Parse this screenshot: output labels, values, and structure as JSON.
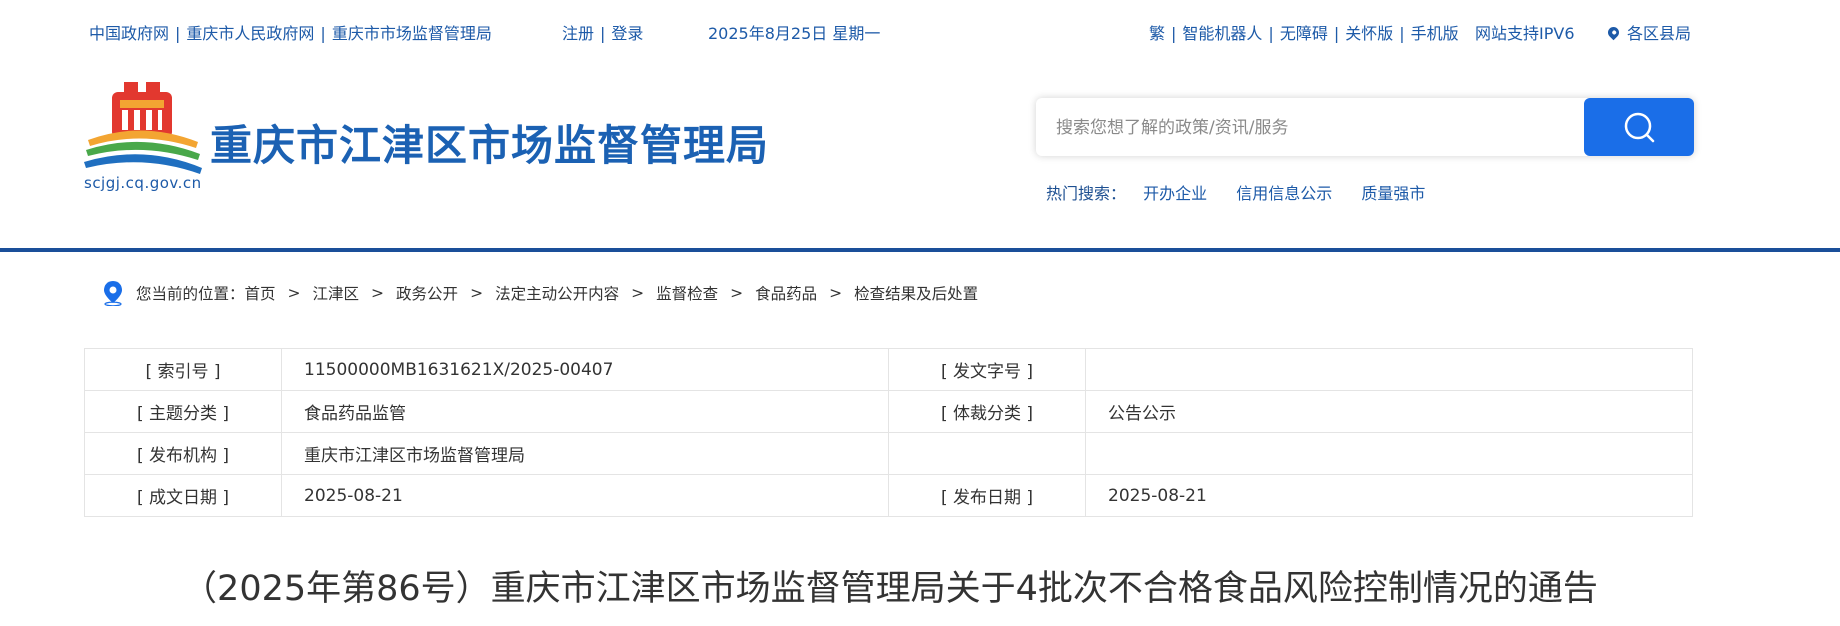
{
  "topbar": {
    "links": [
      "中国政府网",
      "重庆市人民政府网",
      "重庆市市场监督管理局"
    ],
    "register": "注册",
    "login": "登录",
    "date": "2025年8月25日 星期一",
    "right_links": [
      "繁",
      "智能机器人",
      "无障碍",
      "关怀版",
      "手机版"
    ],
    "ipv6": "网站支持IPV6",
    "districts": "各区县局"
  },
  "header": {
    "logo_url_text": "scjgj.cq.gov.cn",
    "site_title": "重庆市江津区市场监督管理局",
    "search_placeholder": "搜索您想了解的政策/资讯/服务",
    "hot_label": "热门搜索：",
    "hot_items": [
      "开办企业",
      "信用信息公示",
      "质量强市"
    ]
  },
  "breadcrumb": {
    "prefix": "您当前的位置：",
    "items": [
      "首页",
      "江津区",
      "政务公开",
      "法定主动公开内容",
      "监督检查",
      "食品药品",
      "检查结果及后处置"
    ]
  },
  "meta_table": [
    {
      "k1": "[ 索引号 ]",
      "v1": "11500000MB1631621X/2025-00407",
      "k2": "[ 发文字号 ]",
      "v2": ""
    },
    {
      "k1": "[ 主题分类 ]",
      "v1": "食品药品监管",
      "k2": "[ 体裁分类 ]",
      "v2": "公告公示"
    },
    {
      "k1": "[ 发布机构 ]",
      "v1": "重庆市江津区市场监督管理局",
      "k2": "",
      "v2": ""
    },
    {
      "k1": "[ 成文日期 ]",
      "v1": "2025-08-21",
      "k2": "[ 发布日期 ]",
      "v2": "2025-08-21"
    }
  ],
  "article": {
    "title": "（2025年第86号）重庆市江津区市场监督管理局关于4批次不合格食品风险控制情况的通告"
  },
  "colors": {
    "primary": "#1b61b3",
    "divider": "#1a4f99",
    "search_button": "#1a6ee8"
  }
}
